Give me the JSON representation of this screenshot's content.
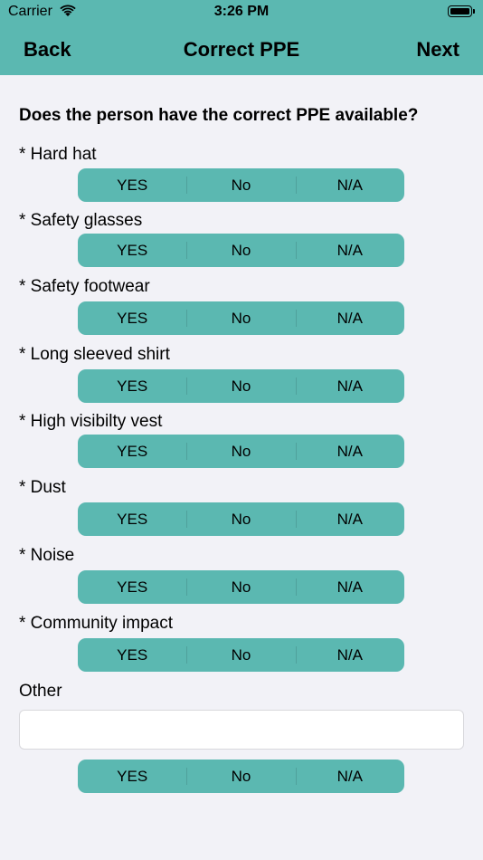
{
  "status_bar": {
    "carrier": "Carrier",
    "time": "3:26 PM",
    "wifi_icon": "wifi-icon",
    "battery_icon": "battery-icon",
    "battery_level": 1.0
  },
  "nav": {
    "back_label": "Back",
    "title": "Correct PPE",
    "next_label": "Next"
  },
  "question": "Does the person have the correct PPE available?",
  "options": [
    "YES",
    "No",
    "N/A"
  ],
  "items": [
    {
      "label": "* Hard hat"
    },
    {
      "label": "* Safety glasses"
    },
    {
      "label": "* Safety footwear"
    },
    {
      "label": "* Long sleeved shirt"
    },
    {
      "label": "* High visibilty vest"
    },
    {
      "label": "* Dust"
    },
    {
      "label": "* Noise"
    },
    {
      "label": "* Community impact"
    }
  ],
  "other": {
    "label": "Other",
    "value": "",
    "placeholder": ""
  },
  "colors": {
    "accent": "#5bb8b1",
    "background": "#f2f2f7"
  }
}
